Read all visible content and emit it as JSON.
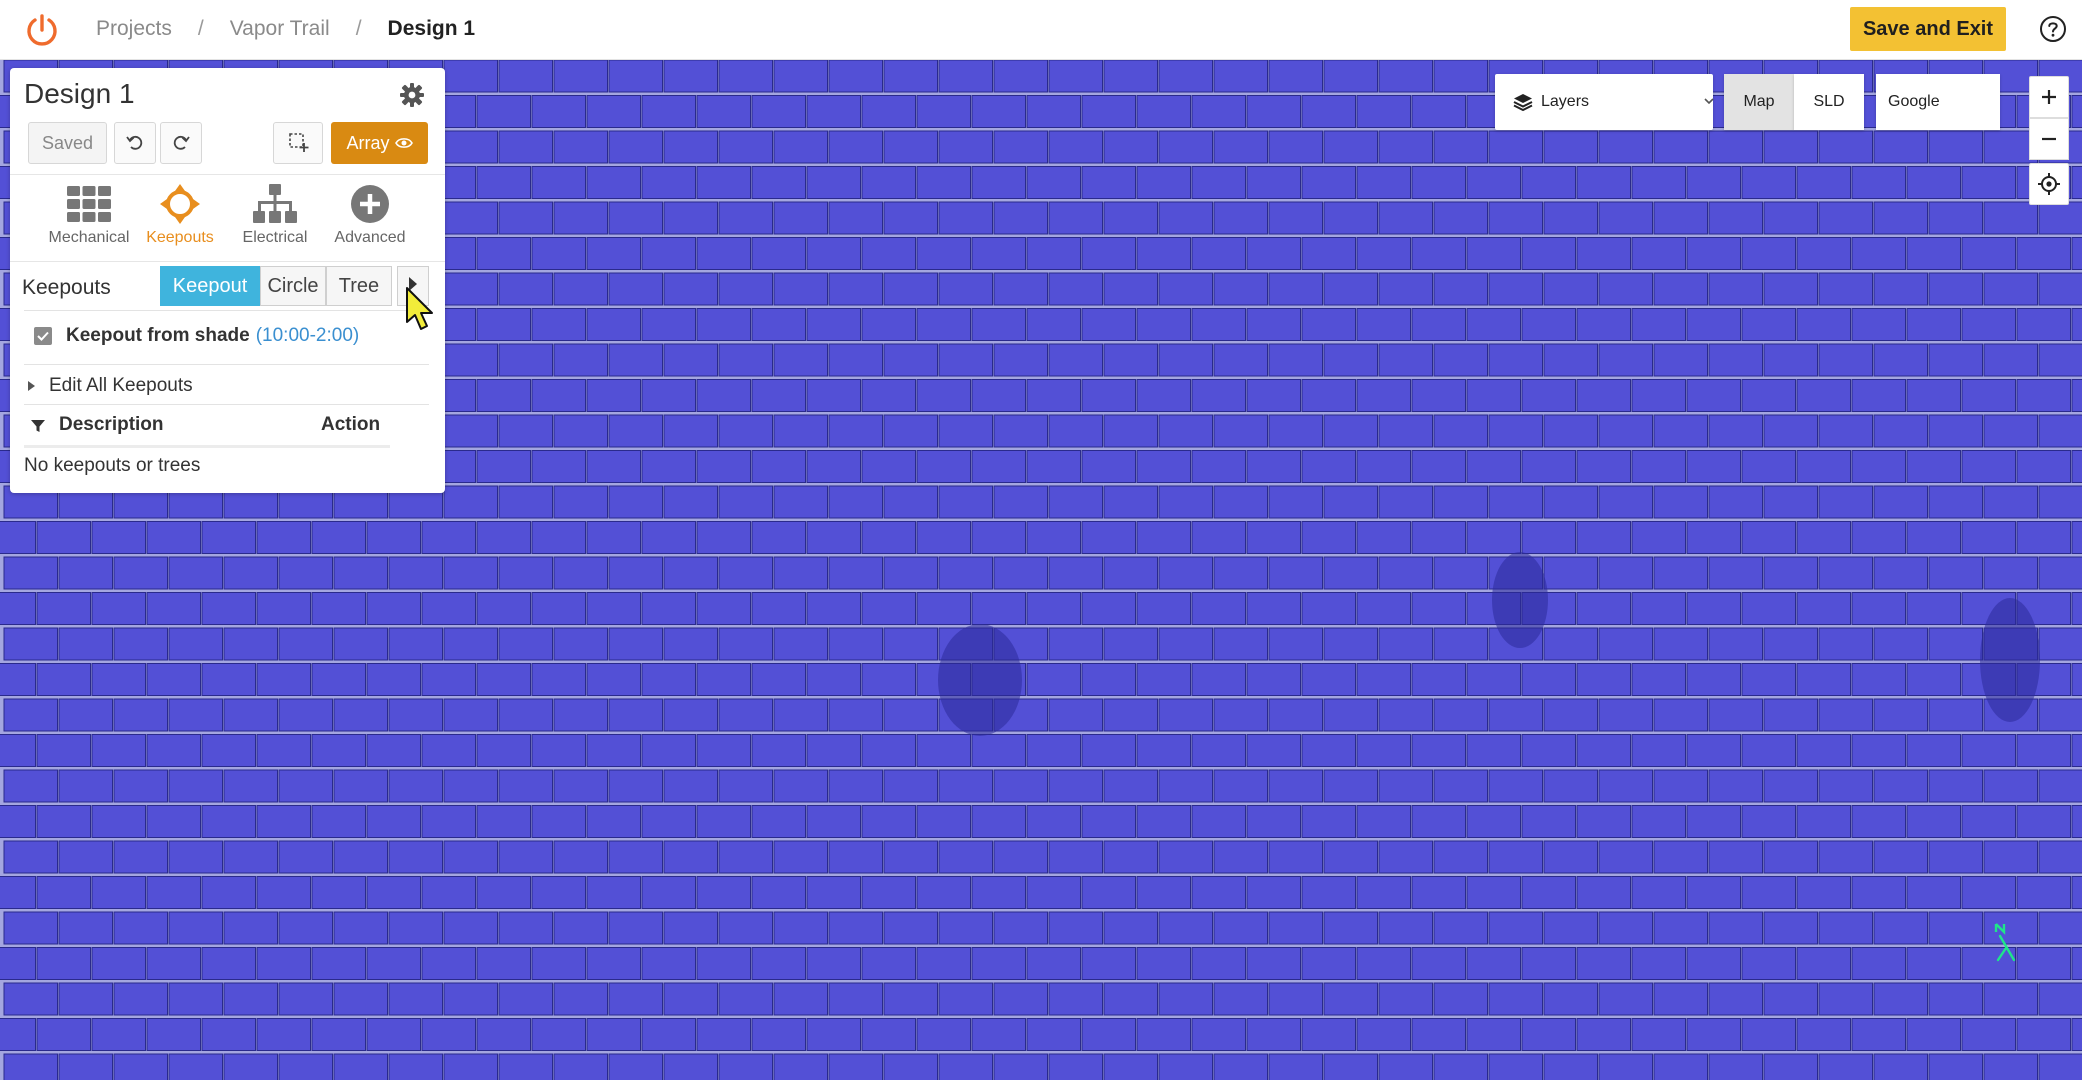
{
  "breadcrumb": {
    "items": [
      "Projects",
      "Vapor Trail",
      "Design 1"
    ],
    "separator": "/"
  },
  "header": {
    "save_exit_label": "Save and Exit",
    "help_icon": "help-circle-icon",
    "logo_icon": "power-icon"
  },
  "panel": {
    "title": "Design 1",
    "saved_label": "Saved",
    "array_label": "Array",
    "tools": [
      {
        "label": "Mechanical",
        "icon": "grid-icon"
      },
      {
        "label": "Keepouts",
        "icon": "keepouts-icon"
      },
      {
        "label": "Electrical",
        "icon": "hierarchy-icon"
      },
      {
        "label": "Advanced",
        "icon": "plus-circle-icon"
      }
    ],
    "active_tool": "Keepouts"
  },
  "keepouts": {
    "title": "Keepouts",
    "tabs": [
      "Keepout",
      "Circle",
      "Tree"
    ],
    "active_tab": "Keepout",
    "shade_label": "Keepout from shade",
    "shade_time": "(10:00-2:00)",
    "shade_checked": true,
    "edit_all_label": "Edit All Keepouts",
    "table_headers": [
      "Description",
      "Action"
    ],
    "empty_text": "No keepouts or trees"
  },
  "map_controls": {
    "layers_label": "Layers",
    "map_label": "Map",
    "sld_label": "SLD",
    "google_label": "Google",
    "active_view": "Map"
  },
  "colors": {
    "accent_orange": "#d98a12",
    "save_yellow": "#f3c133",
    "tab_blue": "#3fb4dd",
    "module_blue": "#5350d6",
    "map_background": "#a4a6e0"
  }
}
